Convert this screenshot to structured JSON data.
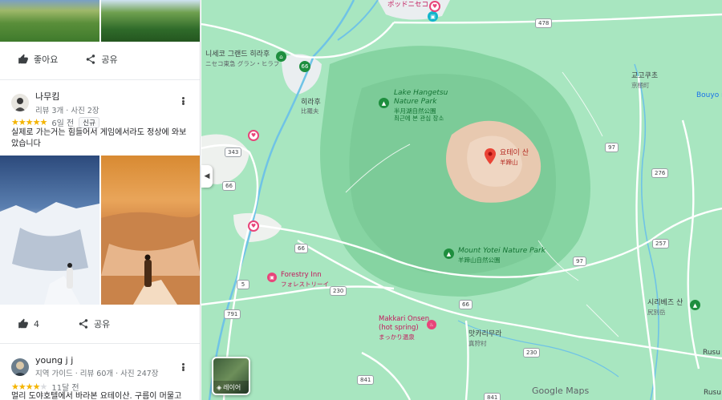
{
  "panel": {
    "top_actions": {
      "like": "좋아요",
      "share": "공유"
    },
    "review1": {
      "name": "나무킴",
      "meta": "리뷰 3개 · 사진 2장",
      "rating": 5,
      "time": "6일 전",
      "badge": "신규",
      "text": "실제로 가는거는 힘들어서 게임에서라도 정상에 와보았습니다",
      "likes": "4",
      "share": "공유"
    },
    "review2": {
      "name": "young j j",
      "meta": "지역 가이드 · 리뷰 60개 · 사진 247장",
      "rating": 4,
      "time": "11달 전",
      "text": "멀리 도야호텔에서 바라본 요테이산. 구름이 머물고"
    }
  },
  "map": {
    "labels": {
      "potnieko": "ポッドニセコ",
      "niseko_grand": "니세코 그랜드 히라후",
      "niseko_grand_jp": "ニセコ東急 グラン・ヒラフ",
      "hirafu": "히라후",
      "hirafu_jp": "比羅夫",
      "hangetsu": "Lake Hangetsu",
      "hangetsu2": "Nature Park",
      "hangetsu_jp": "半月湖自然公園",
      "hangetsu_kr": "최근에 본 관심 장소",
      "yotei": "요테이 산",
      "yotei_jp": "羊蹄山",
      "yotei_park": "Mount Yotei Nature Park",
      "yotei_park_jp": "羊蹄山自然公園",
      "kyogoku": "교고쿠초",
      "kyogoku_jp": "京極町",
      "bouyo": "Bouyo n",
      "forestry": "Forestry Inn",
      "forestry_jp": "フォレストリーイ",
      "makkari_onsen": "Makkari Onsen",
      "makkari_onsen2": "(hot spring)",
      "makkari_onsen_jp": "まっかり温泉",
      "makkari": "맛카리무라",
      "makkari_jp": "真狩村",
      "shiribetsu": "시리베즈 산",
      "shiribetsu_jp": "尻別岳",
      "rusu": "Rusu",
      "rusu_b": "Rusu"
    },
    "shields": [
      "478",
      "343",
      "66",
      "66",
      "5",
      "97",
      "276",
      "257",
      "97",
      "230",
      "66",
      "230",
      "791",
      "841",
      "841",
      "66"
    ],
    "layers_label": "레이어",
    "logo": "Google Maps"
  },
  "colors": {
    "map_bg": "#a8e6c0",
    "forest": "#7fcf9c",
    "mountain": "#e8c9b0",
    "road": "#ffffff",
    "river": "#6fc3e6",
    "accent_pink": "#e8457a",
    "star": "#f4b400"
  }
}
